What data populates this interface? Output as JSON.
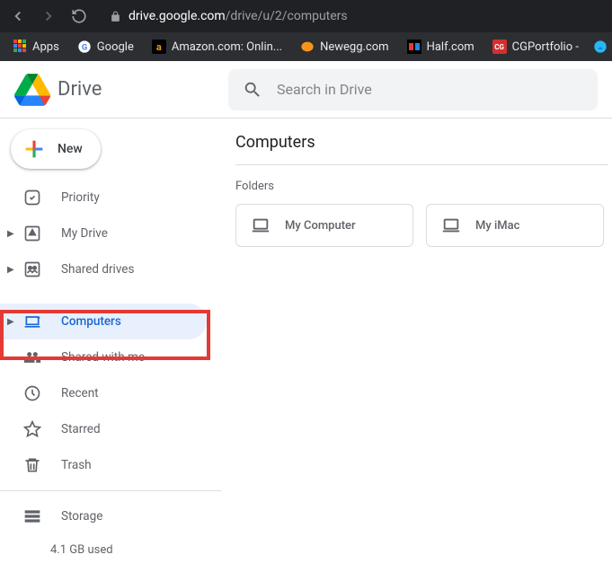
{
  "browser": {
    "url_domain": "drive.google.com",
    "url_path": "/drive/u/2/computers"
  },
  "bookmarks": {
    "apps": "Apps",
    "google": "Google",
    "amazon": "Amazon.com: Onlin...",
    "newegg": "Newegg.com",
    "half": "Half.com",
    "cgportfolio": "CGPortfolio -"
  },
  "header": {
    "title": "Drive",
    "search_placeholder": "Search in Drive"
  },
  "sidebar": {
    "new": "New",
    "priority": "Priority",
    "mydrive": "My Drive",
    "shared_drives": "Shared drives",
    "computers": "Computers",
    "shared_with_me": "Shared with me",
    "recent": "Recent",
    "starred": "Starred",
    "trash": "Trash",
    "storage": "Storage",
    "storage_used": "4.1 GB used"
  },
  "content": {
    "title": "Computers",
    "section": "Folders",
    "folders": {
      "f0": "My Computer",
      "f1": "My iMac"
    }
  }
}
